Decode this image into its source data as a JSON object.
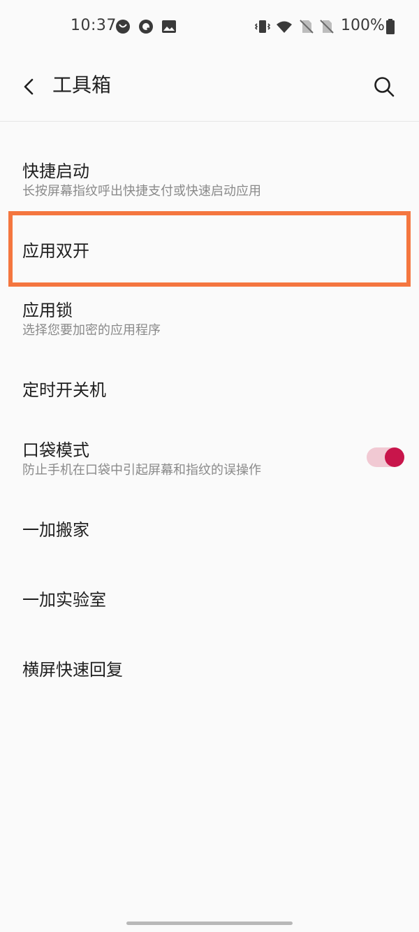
{
  "status_bar": {
    "time": "10:37",
    "battery": "100%",
    "icons": [
      "ring-status-icon",
      "chat-bubble-icon",
      "image-icon",
      "vibrate-icon",
      "wifi-icon",
      "no-sim-icon",
      "no-sim-icon",
      "battery-full-icon"
    ]
  },
  "app_bar": {
    "title": "工具箱",
    "back_icon": "chevron-left-icon",
    "search_icon": "search-icon"
  },
  "items": [
    {
      "title": "快捷启动",
      "subtitle": "长按屏幕指纹呼出快捷支付或快速启动应用"
    },
    {
      "title": "应用双开",
      "subtitle": ""
    },
    {
      "title": "应用锁",
      "subtitle": "选择您要加密的应用程序"
    },
    {
      "title": "定时开关机",
      "subtitle": ""
    },
    {
      "title": "口袋模式",
      "subtitle": "防止手机在口袋中引起屏幕和指纹的误操作",
      "toggle_on": true
    },
    {
      "title": "一加搬家",
      "subtitle": ""
    },
    {
      "title": "一加实验室",
      "subtitle": ""
    },
    {
      "title": "横屏快速回复",
      "subtitle": ""
    }
  ],
  "colors": {
    "accent": "#c8154b",
    "toggle_track": "#f1c9d3",
    "highlight": "#f4763f",
    "background": "#fafafa"
  }
}
